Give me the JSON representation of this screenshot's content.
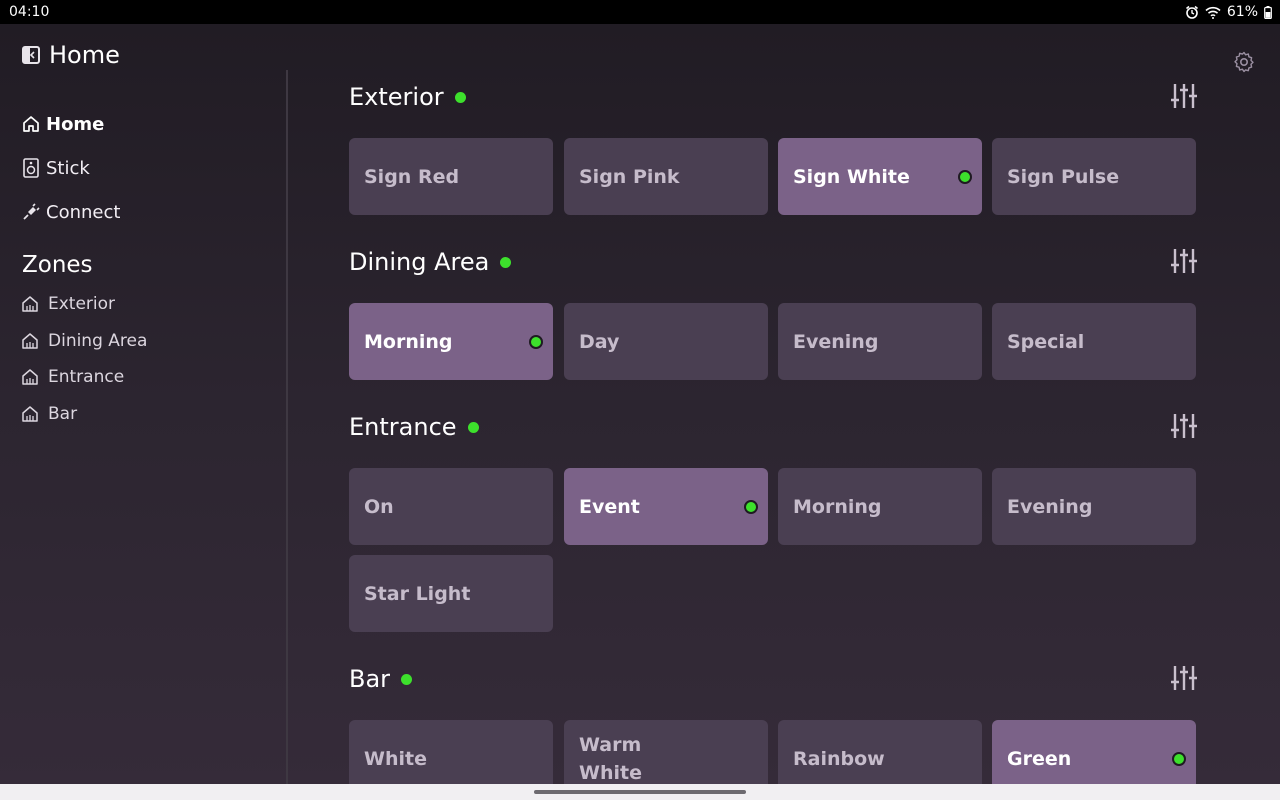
{
  "status_bar": {
    "time": "04:10",
    "battery": "61%",
    "icons": [
      "alarm-icon",
      "wifi-icon",
      "battery-icon"
    ]
  },
  "app": {
    "title": "Home",
    "title_icon": "sidebar-toggle-icon"
  },
  "sidebar": {
    "nav": [
      {
        "label": "Home",
        "icon": "home-icon",
        "active": true
      },
      {
        "label": "Stick",
        "icon": "speaker-icon",
        "active": false
      },
      {
        "label": "Connect",
        "icon": "plug-icon",
        "active": false
      }
    ],
    "zones_heading": "Zones",
    "zones": [
      {
        "label": "Exterior",
        "icon": "zone-home-icon"
      },
      {
        "label": "Dining Area",
        "icon": "zone-home-icon"
      },
      {
        "label": "Entrance",
        "icon": "zone-home-icon"
      },
      {
        "label": "Bar",
        "icon": "zone-home-icon"
      }
    ]
  },
  "zones": [
    {
      "name": "Exterior",
      "status": "on",
      "scenes": [
        {
          "label": "Sign Red",
          "active": false
        },
        {
          "label": "Sign Pink",
          "active": false
        },
        {
          "label": "Sign White",
          "active": true
        },
        {
          "label": "Sign Pulse",
          "active": false
        }
      ]
    },
    {
      "name": "Dining Area",
      "status": "on",
      "scenes": [
        {
          "label": "Morning",
          "active": true
        },
        {
          "label": "Day",
          "active": false
        },
        {
          "label": "Evening",
          "active": false
        },
        {
          "label": "Special",
          "active": false
        }
      ]
    },
    {
      "name": "Entrance",
      "status": "on",
      "scenes": [
        {
          "label": "On",
          "active": false
        },
        {
          "label": "Event",
          "active": true
        },
        {
          "label": "Morning",
          "active": false
        },
        {
          "label": "Evening",
          "active": false
        },
        {
          "label": "Star Light",
          "active": false
        }
      ]
    },
    {
      "name": "Bar",
      "status": "on",
      "scenes": [
        {
          "label": "White",
          "active": false
        },
        {
          "label": "Warm White",
          "active": false
        },
        {
          "label": "Rainbow",
          "active": false
        },
        {
          "label": "Green",
          "active": true
        }
      ]
    }
  ],
  "colors": {
    "accent": "#7b6288",
    "tile": "#4a3f52",
    "status_on": "#3de02c"
  }
}
